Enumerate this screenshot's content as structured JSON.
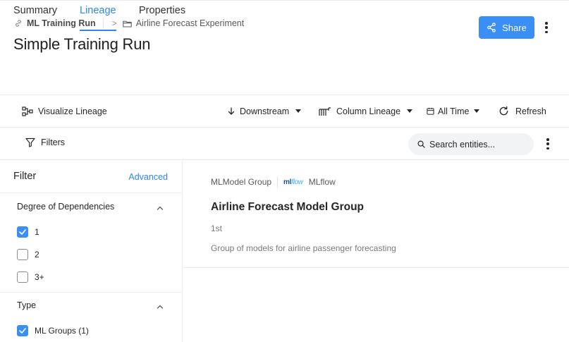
{
  "header": {
    "breadcrumb": [
      {
        "label": "ML Training Run",
        "icon": "link-icon"
      },
      {
        "label": "Airline Forecast Experiment",
        "icon": "folder-icon"
      }
    ],
    "title": "Simple Training Run",
    "share_label": "Share"
  },
  "tabs": [
    {
      "label": "Summary",
      "active": false
    },
    {
      "label": "Lineage",
      "active": true
    },
    {
      "label": "Properties",
      "active": false
    }
  ],
  "toolbar": {
    "visualize_label": "Visualize Lineage",
    "direction_label": "Downstream",
    "column_lineage_label": "Column Lineage",
    "time_label": "All Time",
    "refresh_label": "Refresh"
  },
  "filterbar": {
    "filters_label": "Filters",
    "search_placeholder": "Search entities..."
  },
  "sidebar": {
    "title": "Filter",
    "advanced_label": "Advanced",
    "degree": {
      "title": "Degree of Dependencies",
      "options": [
        {
          "label": "1",
          "checked": true
        },
        {
          "label": "2",
          "checked": false
        },
        {
          "label": "3+",
          "checked": false
        }
      ]
    },
    "type": {
      "title": "Type",
      "options": [
        {
          "label": "ML Groups (1)",
          "checked": true
        }
      ]
    }
  },
  "result": {
    "entity_type": "MLModel Group",
    "platform_logo": "mlflow",
    "platform": "MLflow",
    "name": "Airline Forecast Model Group",
    "degree": "1st",
    "description": "Group of models for airline passenger forecasting"
  },
  "colors": {
    "accent": "#2f86e8",
    "primary_button": "#3b8ef3"
  }
}
